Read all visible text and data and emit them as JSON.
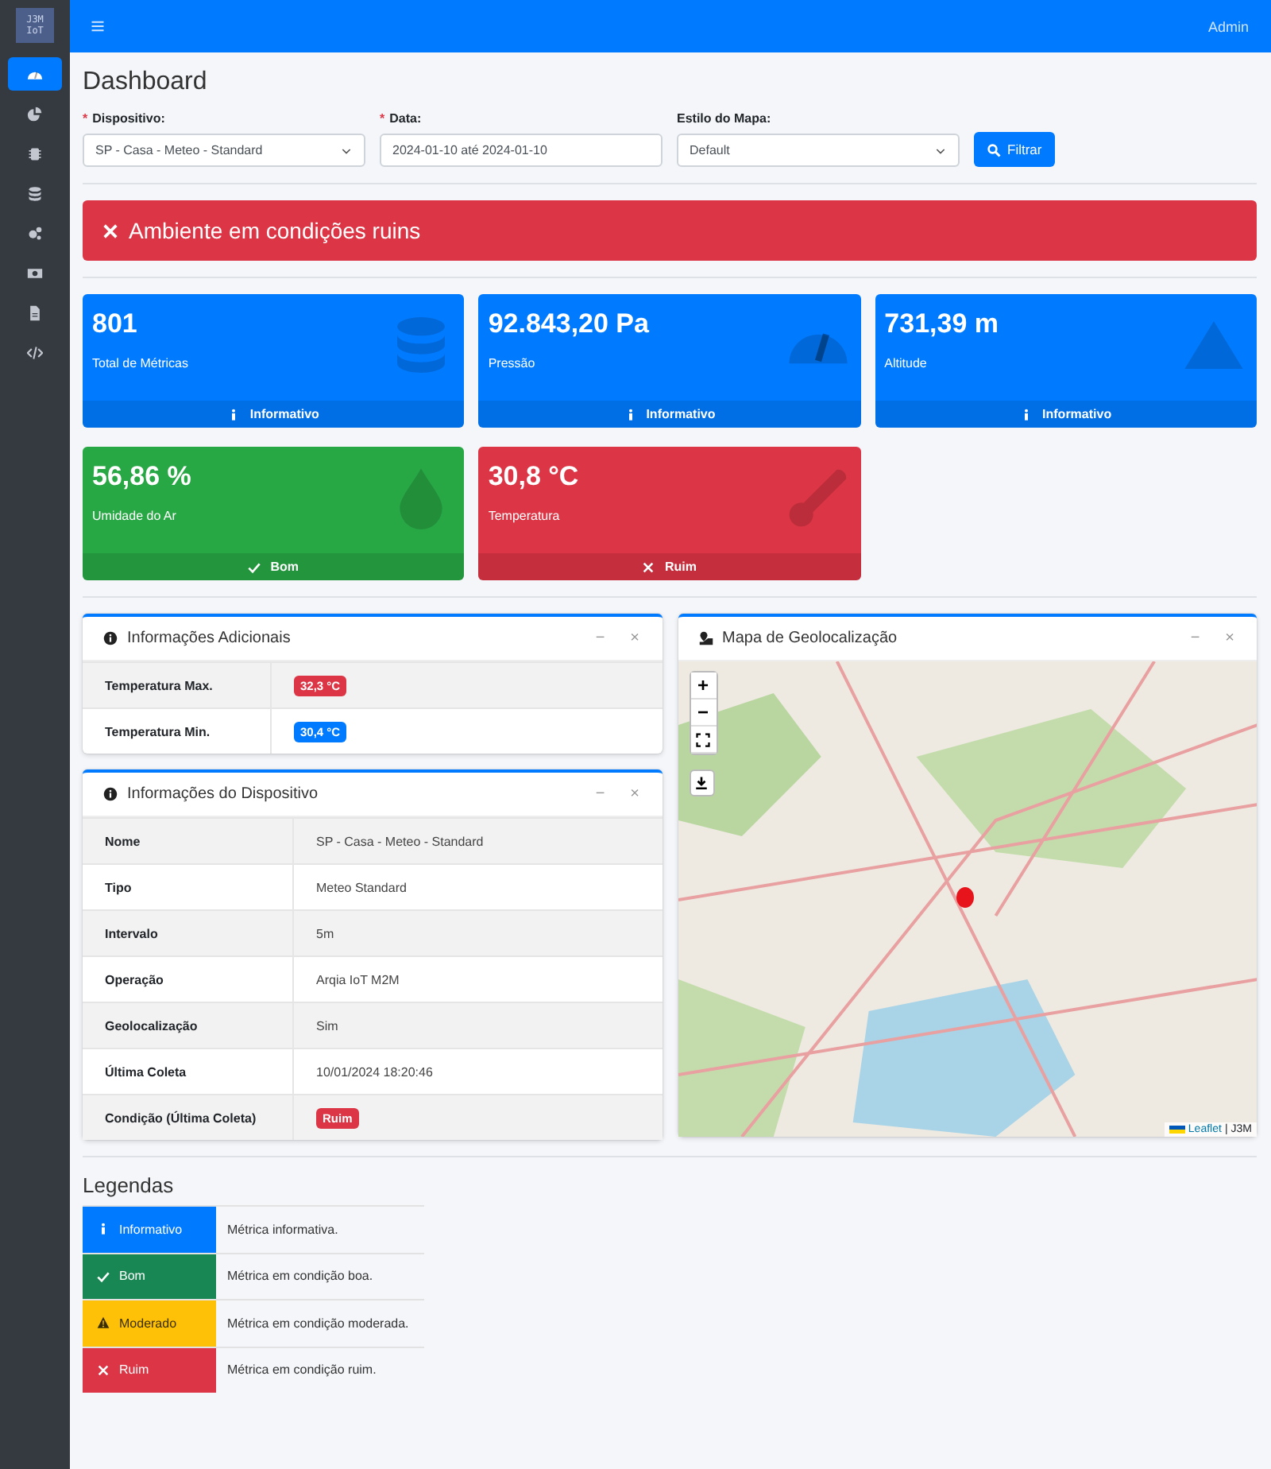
{
  "sidebar": {
    "logo": [
      "J3M",
      "IoT"
    ],
    "items": [
      {
        "kind": "gauge",
        "selected": true
      },
      {
        "kind": "pie",
        "selected": false
      },
      {
        "kind": "chip",
        "selected": false
      },
      {
        "kind": "database",
        "selected": false
      },
      {
        "kind": "gears",
        "selected": false
      },
      {
        "kind": "money",
        "selected": false
      },
      {
        "kind": "file",
        "selected": false
      },
      {
        "kind": "code",
        "selected": false
      }
    ]
  },
  "navbar": {
    "user": "Admin"
  },
  "title": "Dashboard",
  "filters": [
    {
      "mark": "*",
      "label": "Dispositivo:",
      "kind": "select",
      "value": "SP - Casa - Meteo - Standard"
    },
    {
      "mark": "*",
      "label": "Data:",
      "kind": "text",
      "value": "2024-01-10 até 2024-01-10"
    },
    {
      "label": "Estilo do Mapa:",
      "kind": "select",
      "value": "Default"
    }
  ],
  "filter_button": "Filtrar",
  "alert": {
    "kind": "bad",
    "color": "#dc3545",
    "text": "Ambiente em condições ruins"
  },
  "metrics": [
    {
      "value": "801",
      "label": "Total de Métricas",
      "kind": "database",
      "color": "#007bff",
      "footer": {
        "kind": "info",
        "text": "Informativo"
      }
    },
    {
      "value": "92.843,20 Pa",
      "label": "Pressão",
      "kind": "gauge",
      "color": "#007bff",
      "footer": {
        "kind": "info",
        "text": "Informativo"
      }
    },
    {
      "value": "731,39 m",
      "label": "Altitude",
      "kind": "mountain",
      "color": "#007bff",
      "footer": {
        "kind": "info",
        "text": "Informativo"
      }
    },
    {
      "value": "56,86 %",
      "label": "Umidade do Ar",
      "kind": "drop",
      "color": "#28a745",
      "footer": {
        "kind": "good",
        "text": "Bom"
      }
    },
    {
      "value": "30,8 °C",
      "label": "Temperatura",
      "kind": "thermometer",
      "color": "#dc3545",
      "footer": {
        "kind": "bad",
        "text": "Ruim"
      }
    }
  ],
  "additional_info": {
    "title": "Informações Adicionais",
    "controls": [
      "−",
      "×"
    ],
    "rows": [
      {
        "label": "Temperatura Max.",
        "value": "32,3 °C",
        "color": "#dc3545"
      },
      {
        "label": "Temperatura Min.",
        "value": "30,4 °C",
        "color": "#007bff"
      }
    ]
  },
  "device_info": {
    "title": "Informações do Dispositivo",
    "controls": [
      "−",
      "×"
    ],
    "rows": [
      {
        "label": "Nome",
        "value": "SP - Casa - Meteo - Standard"
      },
      {
        "label": "Tipo",
        "value": "Meteo Standard"
      },
      {
        "label": "Intervalo",
        "value": "5m"
      },
      {
        "label": "Operação",
        "value": "Arqia IoT M2M"
      },
      {
        "label": "Geolocalização",
        "value": "Sim"
      },
      {
        "label": "Última Coleta",
        "value": "10/01/2024 18:20:46"
      },
      {
        "label": "Condição (Última Coleta)",
        "value": "Ruim",
        "color": "#dc3545"
      }
    ]
  },
  "map": {
    "title": "Mapa de Geolocalização",
    "controls": [
      "−",
      "×"
    ],
    "zoom_controls": [
      "+",
      "−"
    ],
    "attribution": {
      "link": "Leaflet",
      "separator": "|",
      "text": "J3M"
    }
  },
  "legend": {
    "title": "Legendas",
    "items": [
      {
        "kind": "info",
        "color": "#007bff",
        "label": "Informativo",
        "description": "Métrica informativa."
      },
      {
        "kind": "good",
        "color": "#198754",
        "label": "Bom",
        "description": "Métrica em condição boa."
      },
      {
        "kind": "moderate",
        "color": "#ffc107",
        "label": "Moderado",
        "description": "Métrica em condição moderada."
      },
      {
        "kind": "bad",
        "color": "#dc3545",
        "label": "Ruim",
        "description": "Métrica em condição ruim."
      }
    ]
  }
}
